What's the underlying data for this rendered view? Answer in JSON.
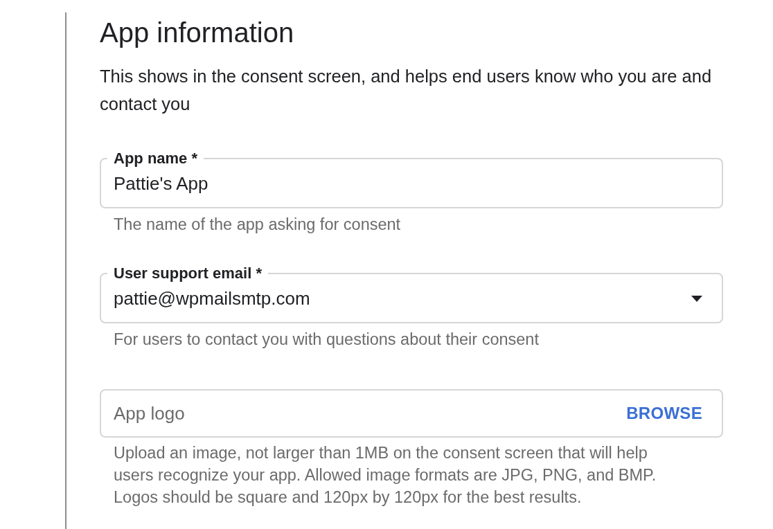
{
  "heading": "App information",
  "description": "This shows in the consent screen, and helps end users know who you are and contact you",
  "fields": [
    {
      "kind": "text",
      "label": "App name *",
      "value": "Pattie's App",
      "helper": "The name of the app asking for consent"
    },
    {
      "kind": "dropdown",
      "label": "User support email *",
      "value": "pattie@wpmailsmtp.com",
      "helper": "For users to contact you with questions about their consent"
    },
    {
      "kind": "file",
      "placeholder": "App logo",
      "action": "BROWSE",
      "helper": "Upload an image, not larger than 1MB on the consent screen that will help users recognize your app. Allowed image formats are JPG, PNG, and BMP. Logos should be square and 120px by 120px for the best results."
    }
  ]
}
